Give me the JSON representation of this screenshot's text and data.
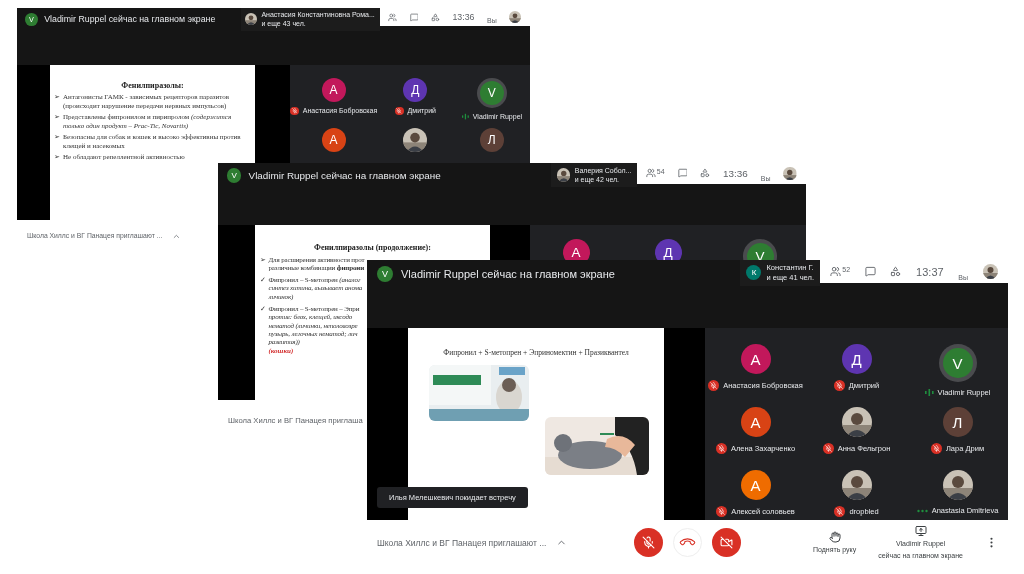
{
  "windows": [
    {
      "banner": {
        "letter": "V",
        "color": "#2e7d32",
        "text": "Vladimir Ruppel сейчас на главном экране"
      },
      "chip": {
        "avatar": {
          "kind": "picture"
        },
        "line1": "Анастасия Константиновна Рома...",
        "line2": "и еще 43 чел."
      },
      "toolbar": {
        "time": "13:36",
        "you": "Вы"
      },
      "slide": {
        "kind": "bullets",
        "title": "Фенилпиразолы:",
        "bullets": [
          {
            "marker": "➢",
            "text": "Антагонисты ГАМК - зависимых рецепторов паразитов (происходит нарушение передачи нервных импульсов)"
          },
          {
            "marker": "➢",
            "text": "Представлены фипронилом и пирипролом *(содержится только один продукт – Prac-Tic, Novartis)*"
          },
          {
            "marker": "➢",
            "text": "Безопасны для собак и кошек и высоко эффективны против клещей и насекомых"
          },
          {
            "marker": "➢",
            "text": "Не обладают репеллентной активностью"
          }
        ]
      },
      "participants": [
        {
          "letter": "А",
          "color": "#c2185b",
          "name": "Анастасия Бобровская",
          "muted": true,
          "speaking": false
        },
        {
          "letter": "Д",
          "color": "#5e35b1",
          "name": "Дмитрий",
          "muted": true,
          "speaking": false
        },
        {
          "letter": "V",
          "color": "#2e7d32",
          "name": "Vladimir Ruppel",
          "muted": false,
          "speaking": true
        },
        {
          "letter": "А",
          "color": "#d84315"
        },
        {
          "kind": "picture"
        },
        {
          "letter": "Л",
          "color": "#5d4037"
        }
      ],
      "footer": {
        "title": "Школа Хиллс и ВГ Панацея приглашают ...",
        "expand_button": true
      }
    },
    {
      "banner": {
        "letter": "V",
        "color": "#2e7d32",
        "text": "Vladimir Ruppel сейчас на главном экране"
      },
      "chip": {
        "avatar": {
          "kind": "picture"
        },
        "line1": "Валерия Собол...",
        "line2": "и еще 42 чел."
      },
      "toolbar": {
        "people_count": "54",
        "time": "13:36",
        "you": "Вы"
      },
      "slide": {
        "kind": "bullets",
        "title": "Фенилпиразолы (продолжение):",
        "bullets": [
          {
            "marker": "➢",
            "lines": [
              "Для расширения активности прот",
              "различные комбинации **фипрони**"
            ]
          },
          {
            "marker": "✓",
            "lines": [
              "Фипронил – S-метопрен *(аналог*",
              "*синтез хитина, вызывает анома*",
              "*личинок)*"
            ]
          },
          {
            "marker": "✓",
            "lines": [
              "Фипронил – S-метопрен – Эпри",
              "*против: блох, клещей, иксодо*",
              "*нематод (личинки, неполовозре*",
              "*пузырь, легочных нематод; лич*",
              "*развития))*"
            ],
            "note": "(кошки)"
          }
        ]
      },
      "participants": [
        {
          "letter": "А",
          "color": "#c2185b"
        },
        {
          "letter": "Д",
          "color": "#5e35b1"
        },
        {
          "letter": "V",
          "color": "#2e7d32",
          "speaking": true
        }
      ],
      "footer": {
        "title": "Школа Хиллс и ВГ Панацея приглаша",
        "expand_button": false
      }
    },
    {
      "banner": {
        "letter": "V",
        "color": "#2e7d32",
        "text": "Vladimir Ruppel сейчас на главном экране"
      },
      "chip": {
        "avatar": {
          "kind": "letter",
          "letter": "К",
          "color": "#00796b"
        },
        "line1": "Константин Г.",
        "line2": "и еще 41 чел."
      },
      "toolbar": {
        "people_count": "52",
        "time": "13:37",
        "you": "Вы"
      },
      "slide": {
        "kind": "images",
        "title": "Фипронил + S-метопрен + Эприномектин + Празиквантел",
        "pictures": [
          {
            "kind": "picture"
          },
          {
            "kind": "picture"
          }
        ]
      },
      "participants": [
        {
          "letter": "А",
          "color": "#c2185b",
          "name": "Анастасия Бобровская",
          "muted": true,
          "speaking": false
        },
        {
          "letter": "Д",
          "color": "#5e35b1",
          "name": "Дмитрий",
          "muted": true,
          "speaking": false
        },
        {
          "letter": "V",
          "color": "#2e7d32",
          "name": "Vladimir Ruppel",
          "muted": false,
          "speaking": true
        },
        {
          "letter": "А",
          "color": "#d84315",
          "name": "Алена Захарченко",
          "muted": true,
          "speaking": false
        },
        {
          "kind": "picture",
          "name": "Анна Фельгрон",
          "muted": true,
          "speaking": false
        },
        {
          "letter": "Л",
          "color": "#5d4037",
          "name": "Лара Дрим",
          "muted": true,
          "speaking": false
        },
        {
          "letter": "А",
          "color": "#ef6c00",
          "name": "Алексей соловьев",
          "muted": true,
          "speaking": false
        },
        {
          "kind": "picture",
          "name": "dropbled",
          "muted": true,
          "speaking": false
        },
        {
          "kind": "picture",
          "name": "Anastasia Dmitrieva",
          "muted": false,
          "speaking": false
        }
      ],
      "toast": "Илья Мелешкевич покидает встречу",
      "footer": {
        "title": "Школа Хиллс и ВГ Панацея приглашают ...",
        "expand_button": true,
        "controls": [
          {
            "kind": "mic_off"
          },
          {
            "kind": "hangup"
          },
          {
            "kind": "cam_off"
          }
        ],
        "actions": [
          {
            "kind": "raise_hand",
            "lines": [
              "Поднять руку"
            ]
          },
          {
            "kind": "present",
            "lines": [
              "Vladimir Ruppel",
              "сейчас на главном экране"
            ]
          },
          {
            "kind": "more"
          }
        ]
      }
    }
  ]
}
